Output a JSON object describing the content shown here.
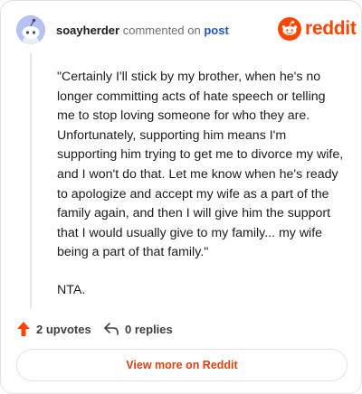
{
  "header": {
    "username": "soayherder",
    "verb": "commented on",
    "target": "post",
    "brand": "reddit"
  },
  "comment": {
    "paragraphs": [
      "\"Certainly I'll stick by my brother, when he's no longer committing acts of hate speech or telling me to stop loving someone for who they are. Unfortunately, supporting him means I'm supporting him trying to get me to divorce my wife, and I won't do that. Let me know when he's ready to apologize and accept my wife as a part of the family again, and then I will give him the support that I would usually give to my family... my wife being a part of that family.\"",
      "NTA."
    ]
  },
  "actions": {
    "upvotes": "2 upvotes",
    "replies": "0 replies"
  },
  "footer": {
    "view_more": "View more on Reddit"
  },
  "colors": {
    "brand": "#ff4500",
    "link": "#2156b8",
    "avatar": "#b7c2f2"
  },
  "icons": {
    "avatar": "snoo-avatar-icon",
    "logo": "reddit-snoo-icon",
    "upvote": "upvote-arrow-icon",
    "reply": "reply-arrow-icon"
  }
}
